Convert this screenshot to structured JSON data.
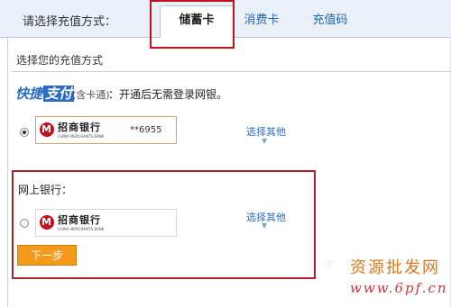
{
  "header": {
    "title": "请选择充值方式：",
    "tabs": [
      {
        "label": "储蓄卡",
        "active": true
      },
      {
        "label": "消费卡",
        "active": false
      },
      {
        "label": "充值码",
        "active": false
      }
    ]
  },
  "main": {
    "subtitle": "选择您的充值方式",
    "quick_pay": {
      "logo_text": "快捷",
      "logo_box_text": "支付",
      "note": "(含卡通)",
      "description": "：开通后无需登录网银。",
      "bank_name": "招商银行",
      "bank_en": "CHINA MERCHANTS BANK",
      "card_number": "**6955",
      "selected": true,
      "select_other": "选择其他"
    },
    "online_bank": {
      "label": "网上银行：",
      "bank_name": "招商银行",
      "bank_en": "CHINA MERCHANTS BANK",
      "selected": false,
      "select_other": "选择其他"
    },
    "next_button": "下一步"
  },
  "watermark": {
    "line1": "资源批发网",
    "line2": "www.6pf.cn"
  },
  "colors": {
    "highlight": "#a8242b",
    "accent": "#2b6dc4",
    "button": "#f49a1b"
  }
}
